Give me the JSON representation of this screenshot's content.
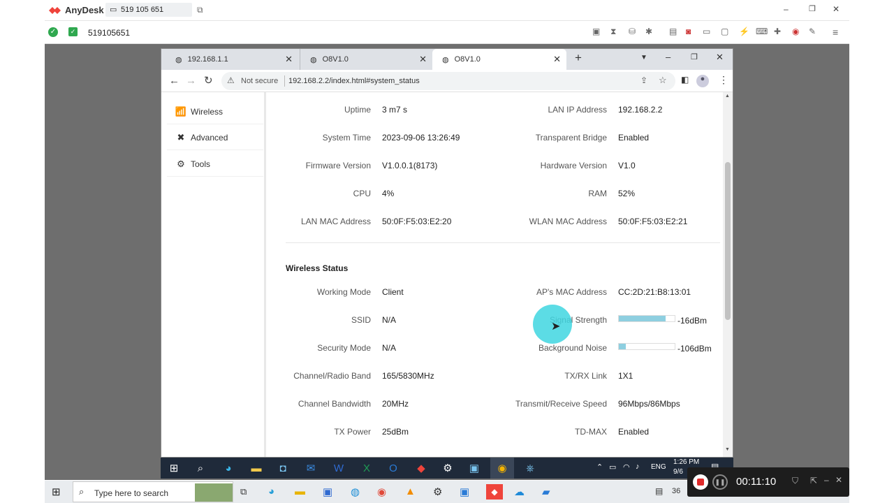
{
  "anydesk": {
    "app_name": "AnyDesk",
    "session_id": "519 105 651",
    "address": "519105651",
    "window_controls": {
      "minimize": "–",
      "restore": "❐",
      "close": "✕"
    }
  },
  "browser": {
    "tabs": [
      {
        "title": "192.168.1.1"
      },
      {
        "title": "O8V1.0"
      },
      {
        "title": "O8V1.0"
      }
    ],
    "new_tab": "+",
    "not_secure": "Not secure",
    "url": "192.168.2.2/index.html#system_status"
  },
  "sidebar": {
    "items": [
      {
        "label": "Wireless",
        "icon": "wifi-icon"
      },
      {
        "label": "Advanced",
        "icon": "tools-cross-icon"
      },
      {
        "label": "Tools",
        "icon": "gears-icon"
      }
    ]
  },
  "system": {
    "rows": [
      {
        "l_label": "Uptime",
        "l_value": "3 m7 s",
        "r_label": "LAN IP Address",
        "r_value": "192.168.2.2"
      },
      {
        "l_label": "System Time",
        "l_value": "2023-09-06 13:26:49",
        "r_label": "Transparent Bridge",
        "r_value": "Enabled"
      },
      {
        "l_label": "Firmware Version",
        "l_value": "V1.0.0.1(8173)",
        "r_label": "Hardware Version",
        "r_value": "V1.0"
      },
      {
        "l_label": "CPU",
        "l_value": "4%",
        "r_label": "RAM",
        "r_value": "52%"
      },
      {
        "l_label": "LAN MAC Address",
        "l_value": "50:0F:F5:03:E2:20",
        "r_label": "WLAN MAC Address",
        "r_value": "50:0F:F5:03:E2:21"
      }
    ]
  },
  "wireless": {
    "heading": "Wireless Status",
    "rows": [
      {
        "l_label": "Working Mode",
        "l_value": "Client",
        "r_label": "AP's MAC Address",
        "r_value": "CC:2D:21:B8:13:01"
      },
      {
        "l_label": "SSID",
        "l_value": "N/A",
        "r_label": "Signal Strength",
        "r_value": "-16dBm"
      },
      {
        "l_label": "Security Mode",
        "l_value": "N/A",
        "r_label": "Background Noise",
        "r_value": "-106dBm"
      },
      {
        "l_label": "Channel/Radio Band",
        "l_value": "165/5830MHz",
        "r_label": "TX/RX Link",
        "r_value": "1X1"
      },
      {
        "l_label": "Channel Bandwidth",
        "l_value": "20MHz",
        "r_label": "Transmit/Receive Speed",
        "r_value": "96Mbps/86Mbps"
      },
      {
        "l_label": "TX Power",
        "l_value": "25dBm",
        "r_label": "TD-MAX",
        "r_value": "Enabled"
      }
    ],
    "signal_fraction": 0.84,
    "noise_fraction": 0.12
  },
  "inner_taskbar": {
    "lang": "ENG",
    "time": "1:26 PM",
    "date": "9/6"
  },
  "outer_taskbar": {
    "search_placeholder": "Type here to search",
    "tray_num": "36"
  },
  "recorder": {
    "timer": "00:11:10"
  },
  "colors": {
    "anydesk_red": "#ef443b",
    "bar_fill": "#8ecfe0",
    "cursor_glow": "#3fd6e0"
  }
}
